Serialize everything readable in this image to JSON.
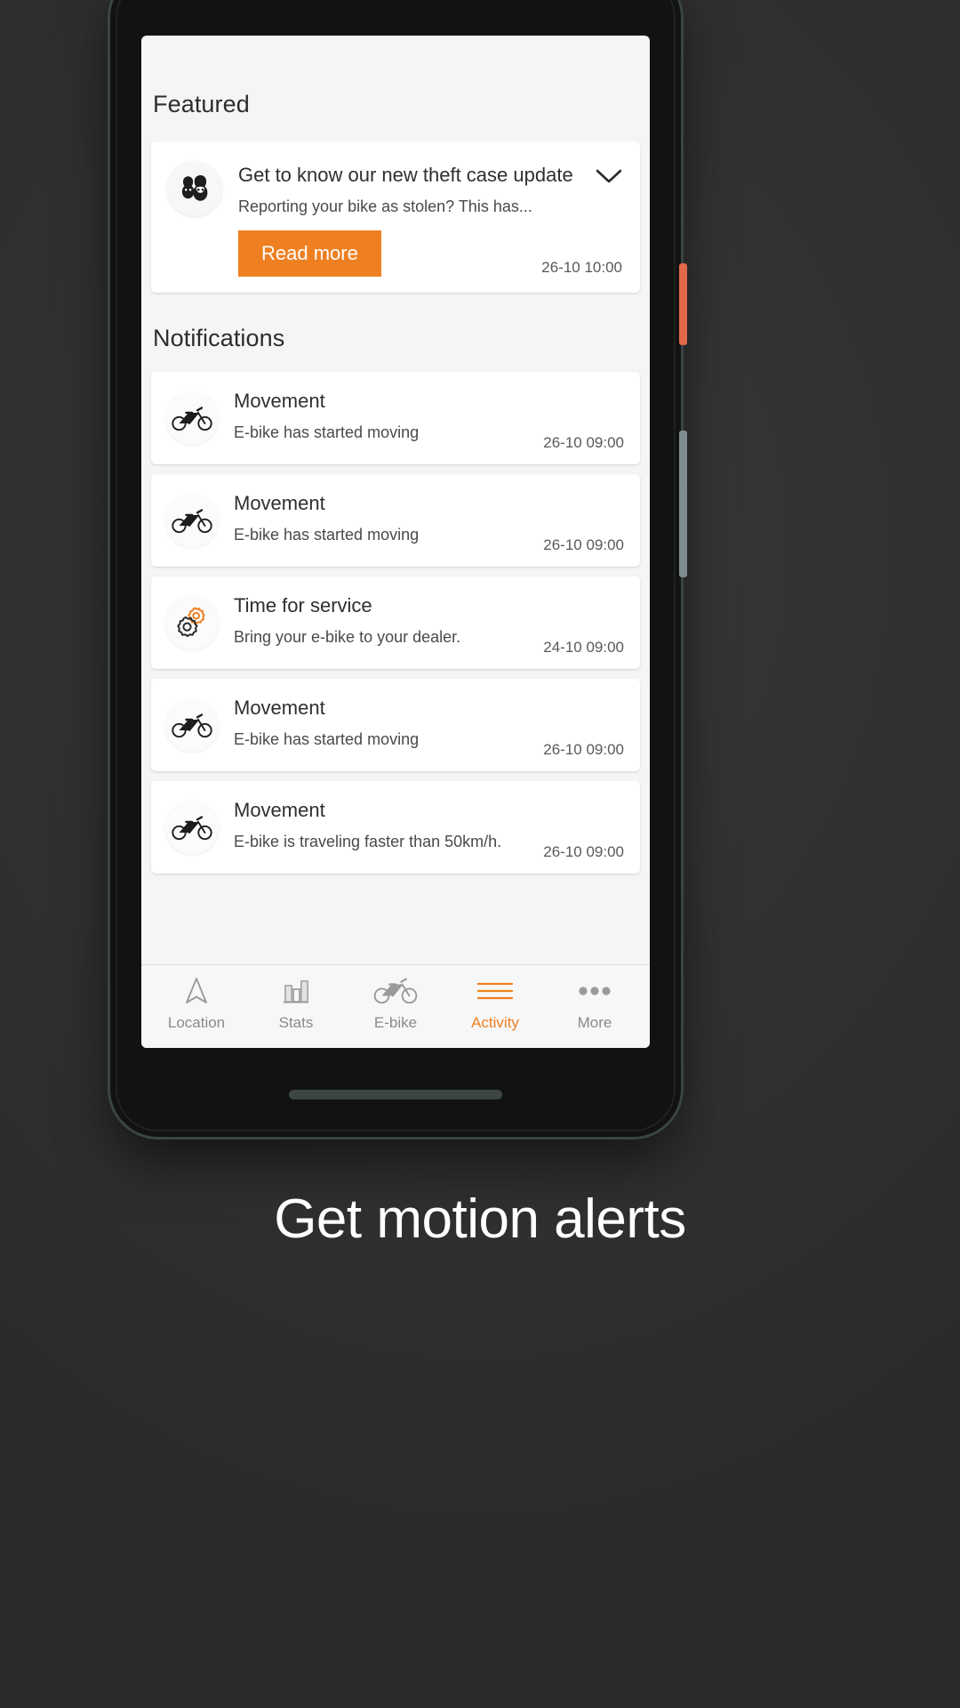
{
  "caption": "Get motion alerts",
  "colors": {
    "accent": "#ef8022",
    "screen_bg": "#f5f5f5",
    "card_bg": "#ffffff",
    "text_primary": "#2f2f2f",
    "text_secondary": "#4a4a4a",
    "text_muted": "#8a8a8a",
    "power_button": "#e2684a",
    "volume_button": "#7d8d90"
  },
  "screen": {
    "featured": {
      "section_title": "Featured",
      "icon": "two-people-icon",
      "title": "Get to know our new theft case update",
      "subtitle": "Reporting your bike as stolen? This has...",
      "button_label": "Read more",
      "expand_icon": "chevron-down-icon",
      "timestamp": "26-10 10:00"
    },
    "notifications": {
      "section_title": "Notifications",
      "items": [
        {
          "icon": "bicycle-icon",
          "title": "Movement",
          "subtitle": "E-bike has started moving",
          "timestamp": "26-10 09:00"
        },
        {
          "icon": "bicycle-icon",
          "title": "Movement",
          "subtitle": "E-bike has started moving",
          "timestamp": "26-10 09:00"
        },
        {
          "icon": "gears-icon",
          "title": "Time for service",
          "subtitle": "Bring your e-bike to your dealer.",
          "timestamp": "24-10 09:00"
        },
        {
          "icon": "bicycle-icon",
          "title": "Movement",
          "subtitle": "E-bike has started moving",
          "timestamp": "26-10 09:00"
        },
        {
          "icon": "bicycle-icon",
          "title": "Movement",
          "subtitle": "E-bike is traveling faster than 50km/h.",
          "timestamp": "26-10 09:00"
        }
      ]
    },
    "tabbar": {
      "tabs": [
        {
          "label": "Location",
          "icon": "navigation-arrow-icon",
          "active": false
        },
        {
          "label": "Stats",
          "icon": "bar-chart-icon",
          "active": false
        },
        {
          "label": "E-bike",
          "icon": "bicycle-icon",
          "active": false
        },
        {
          "label": "Activity",
          "icon": "list-lines-icon",
          "active": true
        },
        {
          "label": "More",
          "icon": "ellipsis-icon",
          "active": false
        }
      ]
    }
  }
}
